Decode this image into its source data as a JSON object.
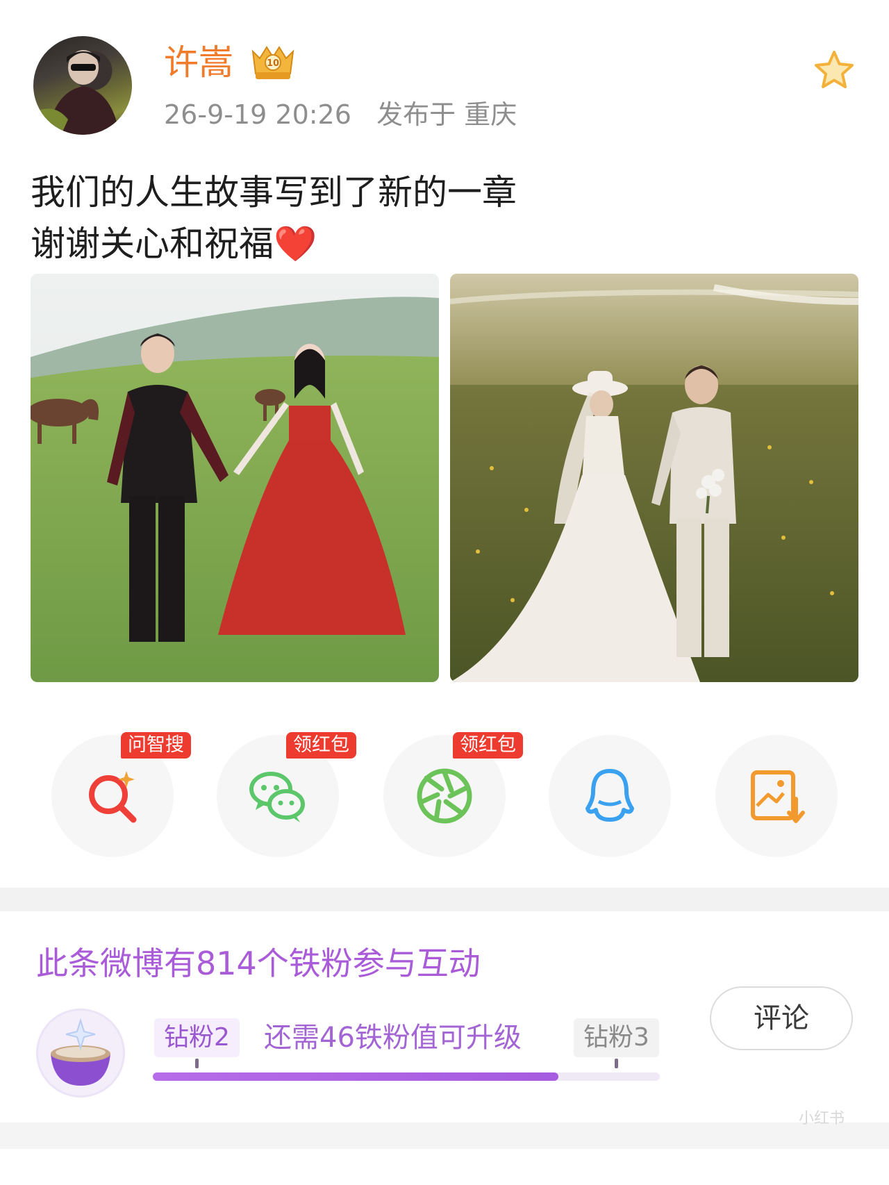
{
  "post": {
    "username": "许嵩",
    "meta": "26-9-19 20:26   发布于 重庆",
    "text_line1": "我们的人生故事写到了新的一章",
    "text_line2": "谢谢关心和祝福",
    "heart": "❤️"
  },
  "share": [
    {
      "icon": "ai-search-icon",
      "tag": "问智搜",
      "color": "#ee4038"
    },
    {
      "icon": "wechat-icon",
      "tag": "领红包",
      "color": "#5cc76a"
    },
    {
      "icon": "moments-icon",
      "tag": "领红包",
      "color": "#6cc35a"
    },
    {
      "icon": "qq-icon",
      "tag": "",
      "color": "#3aa1f0"
    },
    {
      "icon": "save-image-icon",
      "tag": "",
      "color": "#f29a2e"
    }
  ],
  "fans": {
    "title": "此条微博有814个铁粉参与互动",
    "level_current": "钻粉2",
    "level_next": "钻粉3",
    "upgrade_hint": "还需46铁粉值可升级",
    "progress": 0.8,
    "comment_label": "评论"
  },
  "watermark": "小红书",
  "colors": {
    "accent_purple": "#a95bd8",
    "username_orange": "#f07b2a",
    "tag_red": "#ee3b2f"
  }
}
